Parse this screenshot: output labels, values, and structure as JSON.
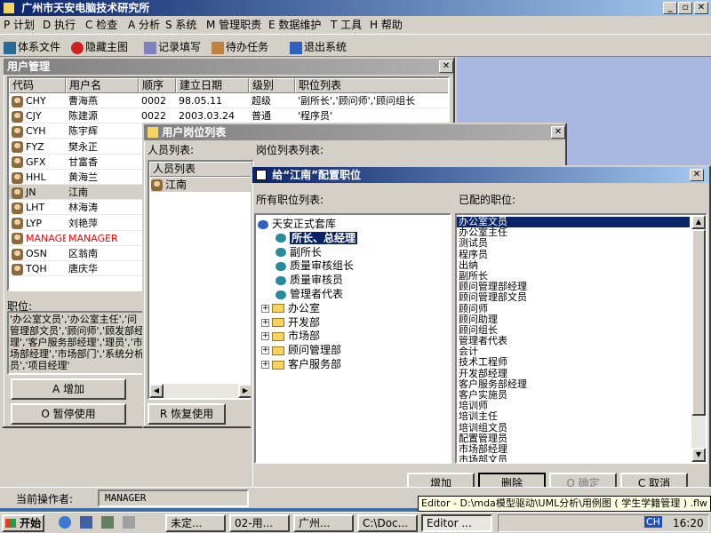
{
  "app": {
    "title": "广州市天安电脑技术研究所"
  },
  "menu": [
    "P 计划",
    "D 执行",
    "C 检查",
    "A 分析",
    "S 系统",
    "M 管理职责",
    "E 数据维护",
    "T 工具",
    "H 帮助"
  ],
  "toolbar": [
    "体系文件",
    "隐藏主图",
    "记录填写",
    "待办任务",
    "退出系统"
  ],
  "user_mgmt": {
    "title": "用户管理",
    "columns": [
      "代码",
      "用户名",
      "顺序",
      "建立日期",
      "级别",
      "职位列表"
    ],
    "rows": [
      {
        "code": "CHY",
        "name": "曹海燕",
        "order": "0002",
        "date": "98.05.11",
        "level": "超级",
        "positions": "'副所长','顾问师','顾问组长"
      },
      {
        "code": "CJY",
        "name": "陈建源",
        "order": "0022",
        "date": "2003.03.24",
        "level": "普通",
        "positions": "'程序员'"
      },
      {
        "code": "CYH",
        "name": "陈宇辉",
        "order": "",
        "date": "",
        "level": "",
        "positions": ""
      },
      {
        "code": "FYZ",
        "name": "樊永正",
        "order": "",
        "date": "",
        "level": "",
        "positions": ""
      },
      {
        "code": "GFX",
        "name": "甘富香",
        "order": "",
        "date": "",
        "level": "",
        "positions": ""
      },
      {
        "code": "HHL",
        "name": "黄海兰",
        "order": "",
        "date": "",
        "level": "",
        "positions": ""
      },
      {
        "code": "JN",
        "name": "江南",
        "order": "",
        "date": "",
        "level": "",
        "positions": ""
      },
      {
        "code": "LHT",
        "name": "林海涛",
        "order": "",
        "date": "",
        "level": "",
        "positions": ""
      },
      {
        "code": "LYP",
        "name": "刘艳萍",
        "order": "",
        "date": "",
        "level": "",
        "positions": ""
      },
      {
        "code": "MANAGER",
        "name": "MANAGER",
        "order": "",
        "date": "",
        "level": "",
        "positions": ""
      },
      {
        "code": "OSN",
        "name": "区翁南",
        "order": "",
        "date": "",
        "level": "",
        "positions": ""
      },
      {
        "code": "TQH",
        "name": "唐庆华",
        "order": "",
        "date": "",
        "level": "",
        "positions": ""
      }
    ],
    "position_label": "职位:",
    "position_text": "'办公室文员','办公室主任','问管理部文员','顾问师','顾发部经理','客户服务部经理','理员','市场部经理','市场部门','系统分析员','项目经理'",
    "buttons": [
      "A 增加",
      "O 暂停使用"
    ]
  },
  "user_pos": {
    "title": "用户岗位列表",
    "people_label": "人员列表:",
    "pos_label": "岗位列表列表:",
    "list_header": "人员列表",
    "selected": "江南",
    "hidden_btn": "R 恢复使用"
  },
  "config": {
    "title": "给“江南”配置职位",
    "all_label": "所有职位列表:",
    "assigned_label": "已配的职位:",
    "tree": [
      {
        "label": "天安正式套库",
        "level": 0,
        "type": "root"
      },
      {
        "label": "所长、总经理",
        "level": 1,
        "type": "pos",
        "selected": true
      },
      {
        "label": "副所长",
        "level": 1,
        "type": "pos"
      },
      {
        "label": "质量审核组长",
        "level": 1,
        "type": "pos"
      },
      {
        "label": "质量审核员",
        "level": 1,
        "type": "pos"
      },
      {
        "label": "管理者代表",
        "level": 1,
        "type": "pos"
      },
      {
        "label": "办公室",
        "level": 1,
        "type": "folder"
      },
      {
        "label": "开发部",
        "level": 1,
        "type": "folder"
      },
      {
        "label": "市场部",
        "level": 1,
        "type": "folder"
      },
      {
        "label": "顾问管理部",
        "level": 1,
        "type": "folder"
      },
      {
        "label": "客户服务部",
        "level": 1,
        "type": "folder"
      }
    ],
    "assigned": [
      "办公室文员",
      "办公室主任",
      "测试员",
      "程序员",
      "出纳",
      "副所长",
      "顾问管理部经理",
      "顾问管理部文员",
      "顾问师",
      "顾问助理",
      "顾问组长",
      "管理者代表",
      "会计",
      "技术工程师",
      "开发部经理",
      "客户服务部经理",
      "客户实施员",
      "培训师",
      "培训主任",
      "培训组文员",
      "配置管理员",
      "市场部经理",
      "市场部文员"
    ],
    "buttons": {
      "add": "增加",
      "delete": "删除",
      "ok": "O 确定",
      "cancel": "C 取消"
    }
  },
  "status": {
    "operator_label": "当前操作者:",
    "operator": "MANAGER"
  },
  "tooltip": "Editor - D:\\mda模型驱动\\UML分析\\用例图 ( 学生学籍管理 ) .flw",
  "taskbar": {
    "start": "开始",
    "items": [
      "未定...",
      "02-用...",
      "广州...",
      "C:\\Doc...",
      "Editor ..."
    ],
    "time": "16:20",
    "ime": "CH"
  },
  "colors": {
    "title_active": "#0a246a",
    "desktop": "#3a6ea5",
    "selection": "#0a246a",
    "manager_red": "#ff0000"
  }
}
